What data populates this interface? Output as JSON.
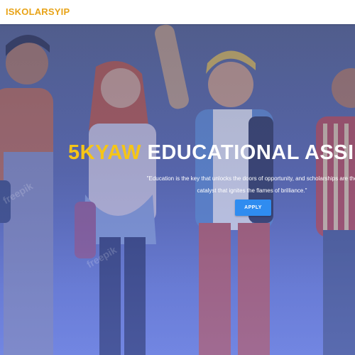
{
  "navbar": {
    "brand": "ISKOLARSYIP"
  },
  "hero": {
    "headline_accent": "5KYAW",
    "headline_rest": " EDUCATIONAL ASSI",
    "quote_line1": "\"Education is the key that unlocks the doors of opportunity, and scholarships are the",
    "quote_line2": "catalyst that ignites the flames of brilliance.\"",
    "apply_label": "APPLY",
    "watermark_text": "freepik"
  },
  "colors": {
    "brand": "#e8a317",
    "accent": "#f5c518",
    "button": "#2f8cf0",
    "hero_top": "#56638c",
    "hero_bottom": "#7488e0"
  }
}
